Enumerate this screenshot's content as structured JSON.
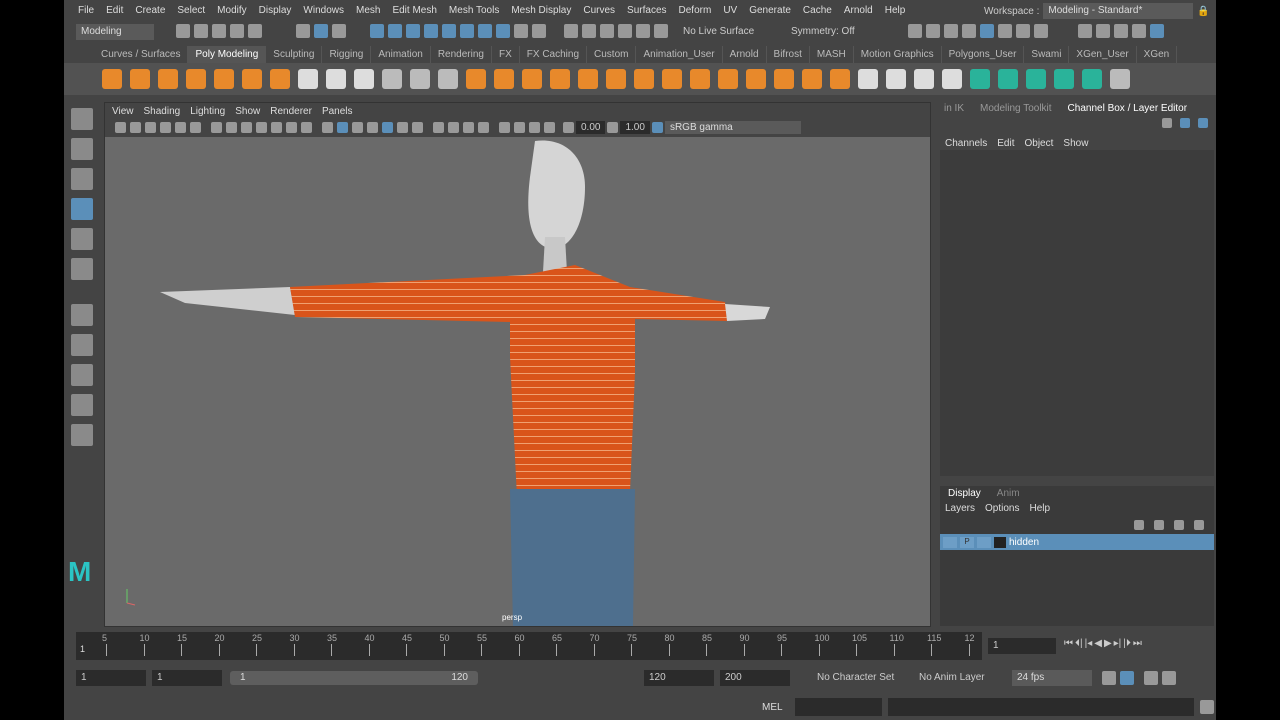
{
  "menu": [
    "File",
    "Edit",
    "Create",
    "Select",
    "Modify",
    "Display",
    "Windows",
    "Mesh",
    "Edit Mesh",
    "Mesh Tools",
    "Mesh Display",
    "Curves",
    "Surfaces",
    "Deform",
    "UV",
    "Generate",
    "Cache",
    "Arnold",
    "Help"
  ],
  "workspace": {
    "label": "Workspace :",
    "value": "Modeling - Standard*"
  },
  "status": {
    "mode": "Modeling",
    "live_surface": "No Live Surface",
    "symmetry": "Symmetry: Off"
  },
  "shelf_tabs": [
    "Curves / Surfaces",
    "Poly Modeling",
    "Sculpting",
    "Rigging",
    "Animation",
    "Rendering",
    "FX",
    "FX Caching",
    "Custom",
    "Animation_User",
    "Arnold",
    "Bifrost",
    "MASH",
    "Motion Graphics",
    "Polygons_User",
    "Swami",
    "XGen_User",
    "XGen"
  ],
  "shelf_active": "Poly Modeling",
  "viewport": {
    "menus": [
      "View",
      "Shading",
      "Lighting",
      "Show",
      "Renderer",
      "Panels"
    ],
    "exposure": "0.00",
    "gamma": "1.00",
    "color_space": "sRGB gamma",
    "camera": "persp"
  },
  "right_panel": {
    "tabs": [
      "in IK",
      "Modeling Toolkit",
      "Channel Box / Layer Editor"
    ],
    "active": "Channel Box / Layer Editor",
    "channel_menus": [
      "Channels",
      "Edit",
      "Object",
      "Show"
    ],
    "layer_tabs": [
      "Display",
      "Anim"
    ],
    "layer_menus": [
      "Layers",
      "Options",
      "Help"
    ],
    "layer": {
      "p": "P",
      "name": "hidden"
    }
  },
  "timeline": {
    "ticks": [
      "5",
      "10",
      "15",
      "20",
      "25",
      "30",
      "35",
      "40",
      "45",
      "50",
      "55",
      "60",
      "65",
      "70",
      "75",
      "80",
      "85",
      "90",
      "95",
      "100",
      "105",
      "110",
      "115",
      "12"
    ],
    "start_marker": "1",
    "current_frame": "1"
  },
  "range": {
    "start": "1",
    "inner_start": "1",
    "slider_start": "1",
    "slider_end": "120",
    "end": "120",
    "max": "200",
    "character_set": "No Character Set",
    "anim_layer": "No Anim Layer",
    "fps": "24 fps"
  },
  "command": {
    "lang": "MEL"
  },
  "colors": {
    "accent": "#5b8fb9",
    "shirt": "#d9541a",
    "jeans": "#4e6f8e"
  }
}
